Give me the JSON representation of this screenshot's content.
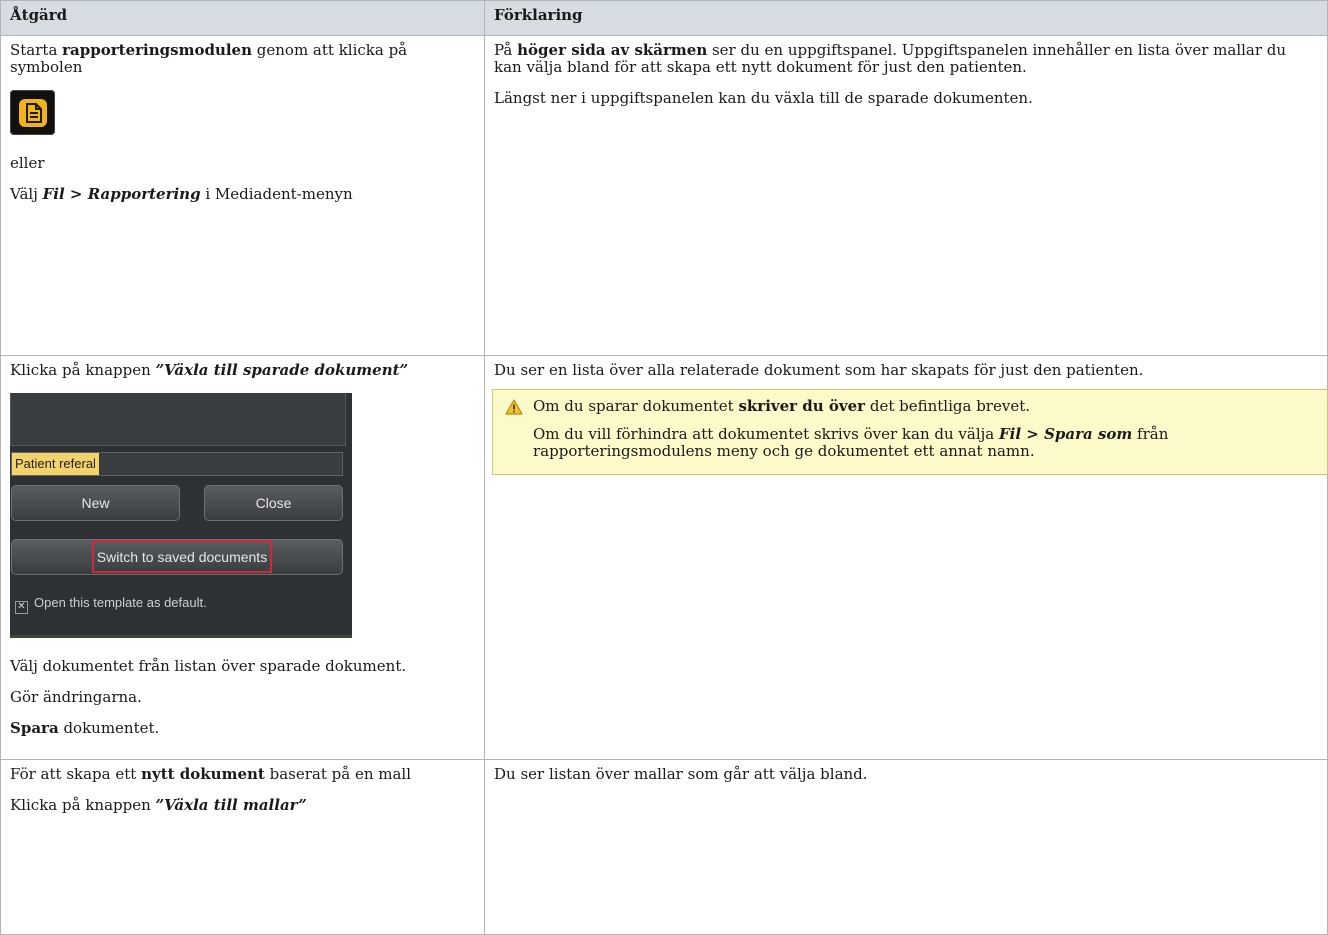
{
  "header": {
    "col1": "Åtgärd",
    "col2": "Förklaring"
  },
  "row1": {
    "left": {
      "p1_a": "Starta ",
      "p1_b": "rapporteringsmodulen",
      "p1_c": " genom att klicka på symbolen",
      "icon": "report-document-icon",
      "p2": "eller",
      "p3_a": "Välj ",
      "p3_b": "Fil",
      "p3_c": " > ",
      "p3_d": "Rapportering",
      "p3_e": " i Mediadent-menyn"
    },
    "right": {
      "p1_a": "På ",
      "p1_b": "höger sida av skärmen",
      "p1_c": " ser du en uppgiftspanel. Uppgiftspanelen innehåller en lista över mallar du kan välja bland för att skapa ett nytt dokument för just den patienten.",
      "p2": "Längst ner i uppgiftspanelen kan du växla till de sparade dokumenten."
    }
  },
  "row2": {
    "left": {
      "p1_a": "Klicka på knappen ",
      "p1_b": "”Växla till sparade dokument”",
      "screenshot": {
        "field_value": "Patient referal",
        "new_label": "New",
        "close_label": "Close",
        "switch_label": "Switch to saved documents",
        "checkbox_label": "Open this template as default."
      },
      "p2": "Välj dokumentet från listan över sparade dokument.",
      "p3": "Gör ändringarna.",
      "p4_a": "Spara",
      "p4_b": " dokumentet."
    },
    "right": {
      "p1": "Du ser en lista över alla relaterade dokument som har skapats för just den patienten.",
      "note": {
        "icon": "warning-icon",
        "l1_a": "Om du sparar dokumentet ",
        "l1_b": "skriver du över",
        "l1_c": " det befintliga brevet.",
        "l2_a": "Om du vill förhindra att dokumentet skrivs över kan du välja ",
        "l2_b": "Fil > Spara som",
        "l2_c": " från rapporteringsmodulens meny och ge dokumentet ett annat namn."
      }
    }
  },
  "row3": {
    "left": {
      "p1_a": "För att skapa ett ",
      "p1_b": "nytt dokument",
      "p1_c": " baserat på en mall",
      "p2_a": "Klicka på knappen ",
      "p2_b": "”Växla till mallar”"
    },
    "right": {
      "p1": "Du ser listan över mallar som går att välja bland."
    }
  },
  "colors": {
    "header_bg": "#d7dce3",
    "note_bg": "#fcfac9",
    "icon_accent": "#f3b21b",
    "highlight_border": "#d0293b"
  }
}
